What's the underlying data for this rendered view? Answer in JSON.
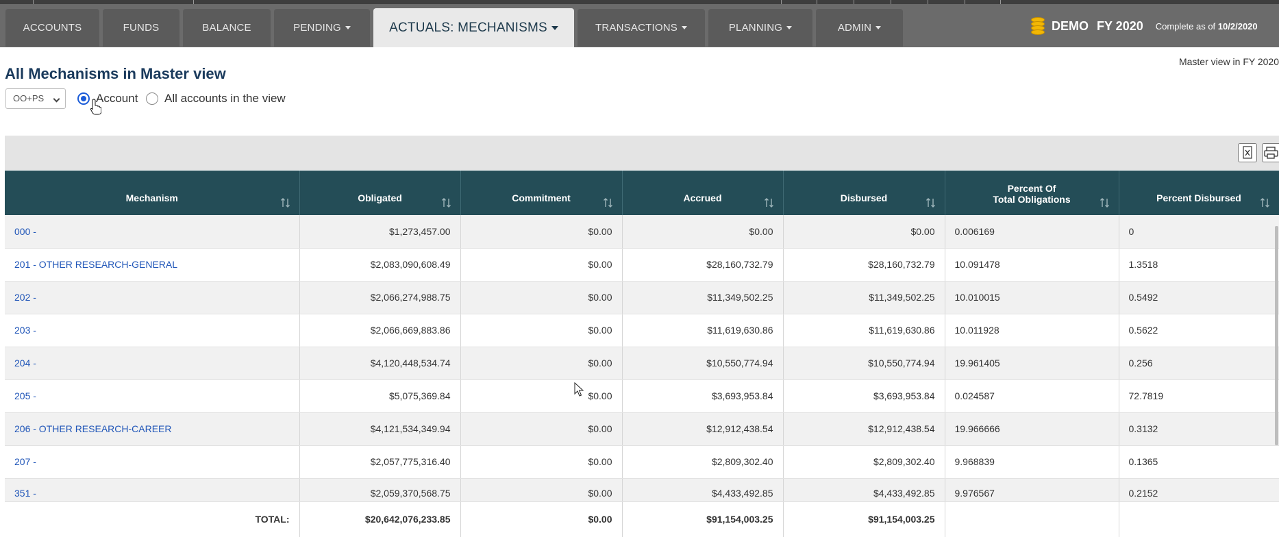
{
  "nav": {
    "tabs": [
      {
        "label": "ACCOUNTS",
        "dropdown": false
      },
      {
        "label": "FUNDS",
        "dropdown": false
      },
      {
        "label": "BALANCE",
        "dropdown": false
      },
      {
        "label": "PENDING",
        "dropdown": true
      },
      {
        "label": "ACTUALS: MECHANISMS",
        "dropdown": true,
        "active": true
      },
      {
        "label": "TRANSACTIONS",
        "dropdown": true
      },
      {
        "label": "PLANNING",
        "dropdown": true
      },
      {
        "label": "ADMIN",
        "dropdown": true
      }
    ],
    "status": {
      "demo": "DEMO",
      "fy": "FY 2020",
      "complete_prefix": "Complete as of",
      "complete_date": "10/2/2020",
      "icon": "coins-icon"
    }
  },
  "header": {
    "title": "All Mechanisms in Master view",
    "master_view": "Master view in FY 2020",
    "select_value": "OO+PS",
    "radio_account": "Account",
    "radio_all": "All accounts in the view",
    "selected_radio": "Account"
  },
  "table": {
    "columns": [
      "Mechanism",
      "Obligated",
      "Commitment",
      "Accrued",
      "Disbursed",
      "Percent Of Total Obligations",
      "Percent Disbursed"
    ],
    "column_lines": {
      "pct_line1": "Percent Of",
      "pct_line2": "Total Obligations"
    },
    "rows": [
      {
        "mechanism": "000 -",
        "obligated": "$1,273,457.00",
        "commitment": "$0.00",
        "accrued": "$0.00",
        "disbursed": "$0.00",
        "pct_total": "0.006169",
        "pct_disbursed": "0"
      },
      {
        "mechanism": "201 - OTHER RESEARCH-GENERAL",
        "obligated": "$2,083,090,608.49",
        "commitment": "$0.00",
        "accrued": "$28,160,732.79",
        "disbursed": "$28,160,732.79",
        "pct_total": "10.091478",
        "pct_disbursed": "1.3518"
      },
      {
        "mechanism": "202 -",
        "obligated": "$2,066,274,988.75",
        "commitment": "$0.00",
        "accrued": "$11,349,502.25",
        "disbursed": "$11,349,502.25",
        "pct_total": "10.010015",
        "pct_disbursed": "0.5492"
      },
      {
        "mechanism": "203 -",
        "obligated": "$2,066,669,883.86",
        "commitment": "$0.00",
        "accrued": "$11,619,630.86",
        "disbursed": "$11,619,630.86",
        "pct_total": "10.011928",
        "pct_disbursed": "0.5622"
      },
      {
        "mechanism": "204 -",
        "obligated": "$4,120,448,534.74",
        "commitment": "$0.00",
        "accrued": "$10,550,774.94",
        "disbursed": "$10,550,774.94",
        "pct_total": "19.961405",
        "pct_disbursed": "0.256"
      },
      {
        "mechanism": "205 -",
        "obligated": "$5,075,369.84",
        "commitment": "$0.00",
        "accrued": "$3,693,953.84",
        "disbursed": "$3,693,953.84",
        "pct_total": "0.024587",
        "pct_disbursed": "72.7819"
      },
      {
        "mechanism": "206 - OTHER RESEARCH-CAREER",
        "obligated": "$4,121,534,349.94",
        "commitment": "$0.00",
        "accrued": "$12,912,438.54",
        "disbursed": "$12,912,438.54",
        "pct_total": "19.966666",
        "pct_disbursed": "0.3132"
      },
      {
        "mechanism": "207 -",
        "obligated": "$2,057,775,316.40",
        "commitment": "$0.00",
        "accrued": "$2,809,302.40",
        "disbursed": "$2,809,302.40",
        "pct_total": "9.968839",
        "pct_disbursed": "0.1365"
      },
      {
        "mechanism": "351 -",
        "obligated": "$2,059,370,568.75",
        "commitment": "$0.00",
        "accrued": "$4,433,492.85",
        "disbursed": "$4,433,492.85",
        "pct_total": "9.976567",
        "pct_disbursed": "0.2152"
      }
    ],
    "total": {
      "label": "TOTAL:",
      "obligated": "$20,642,076,233.85",
      "commitment": "$0.00",
      "accrued": "$91,154,003.25",
      "disbursed": "$91,154,003.25"
    }
  },
  "colors": {
    "nav_bg": "#6b6b6b",
    "header_bg": "#244d57",
    "link": "#1f55b8",
    "title": "#1a3a5c",
    "radio_accent": "#1a5bd8",
    "coin": "#f2b705"
  }
}
